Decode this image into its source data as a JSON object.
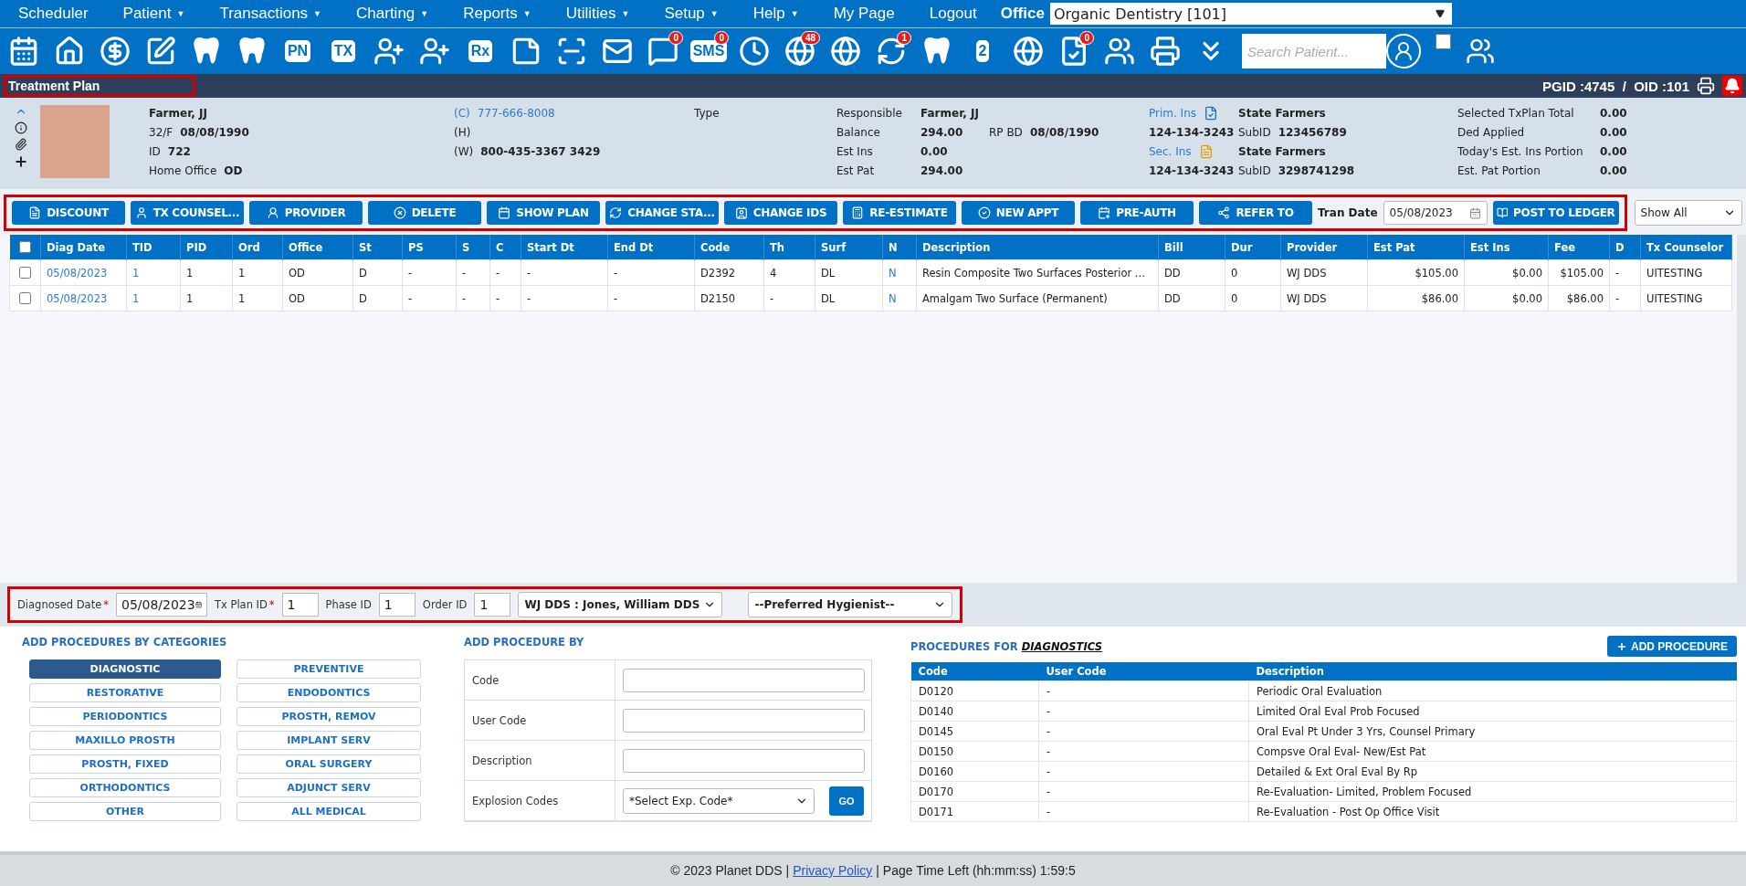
{
  "menu": [
    {
      "label": "Scheduler"
    },
    {
      "label": "Patient",
      "caret": "▼"
    },
    {
      "label": "Transactions",
      "caret": "▼"
    },
    {
      "label": "Charting",
      "caret": "▼"
    },
    {
      "label": "Reports",
      "caret": "▼"
    },
    {
      "label": "Utilities",
      "caret": "▼"
    },
    {
      "label": "Setup",
      "caret": "▼"
    },
    {
      "label": "Help",
      "caret": "▼"
    },
    {
      "label": "My Page"
    },
    {
      "label": "Logout"
    }
  ],
  "office": {
    "label": "Office",
    "value": "Organic Dentistry [101]"
  },
  "toolbar": [
    {
      "kind": "calendar"
    },
    {
      "kind": "home"
    },
    {
      "kind": "dollar"
    },
    {
      "kind": "edit"
    },
    {
      "kind": "tooth"
    },
    {
      "kind": "teeth"
    },
    {
      "kind": "text",
      "label": "PN"
    },
    {
      "kind": "text",
      "label": "TX"
    },
    {
      "kind": "user-plus"
    },
    {
      "kind": "user-plus"
    },
    {
      "kind": "text",
      "label": "Rx"
    },
    {
      "kind": "note"
    },
    {
      "kind": "scan"
    },
    {
      "kind": "mail"
    },
    {
      "kind": "chat",
      "badge": "0"
    },
    {
      "kind": "text",
      "label": "SMS",
      "badge": "0"
    },
    {
      "kind": "clock"
    },
    {
      "kind": "globe",
      "badge": "48"
    },
    {
      "kind": "globe"
    },
    {
      "kind": "sync",
      "badge": "1"
    },
    {
      "kind": "tooth"
    },
    {
      "kind": "text",
      "label": "2"
    },
    {
      "kind": "globe"
    },
    {
      "kind": "doc-check",
      "badge": "0"
    },
    {
      "kind": "group"
    },
    {
      "kind": "printer"
    },
    {
      "kind": "chevrons"
    }
  ],
  "search": {
    "placeholder": "Search Patient...",
    "option_checked": false
  },
  "page": {
    "title": "Treatment Plan",
    "ids": "PGID :4745  /  OID :101"
  },
  "patient": {
    "name": "Farmer, JJ",
    "age_sex": "32/F",
    "dob": "08/08/1990",
    "id_label": "ID",
    "id": "722",
    "home_office_label": "Home Office",
    "home_office": "OD",
    "phones": [
      {
        "label": "(C)",
        "value": "777-666-8008",
        "link": true
      },
      {
        "label": "(H)"
      },
      {
        "label": "(W)",
        "value": "800-435-3367 3429",
        "link": false
      }
    ],
    "type_label": "Type"
  },
  "account": [
    {
      "label": "Responsible",
      "value": "Farmer, JJ"
    },
    {
      "label": "Balance",
      "value": "294.00"
    },
    {
      "label": "Est Ins",
      "value": "0.00"
    },
    {
      "label": "Est Pat",
      "value": "294.00"
    }
  ],
  "rp_bd": {
    "label": "RP BD",
    "value": "08/08/1990"
  },
  "insurance": [
    {
      "label": "Prim. Ins",
      "phone": "124-134-3243",
      "carrier": "State Farmers",
      "subid_label": "SubID",
      "subid": "123456789"
    },
    {
      "label": "Sec. Ins",
      "phone": "124-134-3243",
      "carrier": "State Farmers",
      "subid_label": "SubID",
      "subid": "3298741298"
    }
  ],
  "totals": [
    {
      "label": "Selected TxPlan Total",
      "value": "0.00"
    },
    {
      "label": "Ded Applied",
      "value": "0.00"
    },
    {
      "label": "Today's Est. Ins Portion",
      "value": "0.00"
    },
    {
      "label": "Est. Pat Portion",
      "value": "0.00"
    }
  ],
  "actions": [
    "DISCOUNT",
    "TX COUNSEL...",
    "PROVIDER",
    "DELETE",
    "SHOW PLAN",
    "CHANGE STA...",
    "CHANGE IDS",
    "RE-ESTIMATE",
    "NEW APPT",
    "PRE-AUTH",
    "REFER TO"
  ],
  "tran_date": {
    "label": "Tran Date",
    "value": "05/08/2023"
  },
  "post_button": "POST TO LEDGER",
  "filter": "Show All",
  "table": {
    "all_checked": false,
    "columns": [
      {
        "label": "Diag Date",
        "link": true
      },
      {
        "label": "TID",
        "link": true
      },
      {
        "label": "PID",
        "link": false
      },
      {
        "label": "Ord",
        "link": false
      },
      {
        "label": "Office",
        "link": false
      },
      {
        "label": "St",
        "link": false
      },
      {
        "label": "PS",
        "link": false
      },
      {
        "label": "S",
        "link": false
      },
      {
        "label": "C",
        "link": false
      },
      {
        "label": "Start Dt",
        "link": false
      },
      {
        "label": "End Dt",
        "link": false
      },
      {
        "label": "Code",
        "link": false
      },
      {
        "label": "Th",
        "link": false
      },
      {
        "label": "Surf",
        "link": false
      },
      {
        "label": "N",
        "link": true
      },
      {
        "label": "Description",
        "link": false
      },
      {
        "label": "Bill",
        "link": false
      },
      {
        "label": "Dur",
        "link": false
      },
      {
        "label": "Provider",
        "link": false
      },
      {
        "label": "Est Pat",
        "link": false
      },
      {
        "label": "Est Ins",
        "link": false
      },
      {
        "label": "Fee",
        "link": false
      },
      {
        "label": "D",
        "link": false
      },
      {
        "label": "Tx Counselor",
        "link": false
      }
    ],
    "rows": [
      {
        "checked": false,
        "cells": [
          "05/08/2023",
          "1",
          "1",
          "1",
          "OD",
          "D",
          "-",
          "-",
          "-",
          "-",
          "-",
          "D2392",
          "4",
          "DL",
          "N",
          "Resin Composite Two Surfaces Posterior ...",
          "DD",
          "0",
          "WJ DDS",
          "$105.00",
          "$0.00",
          "$105.00",
          "-",
          "UITESTING"
        ]
      },
      {
        "checked": false,
        "cells": [
          "05/08/2023",
          "1",
          "1",
          "1",
          "OD",
          "D",
          "-",
          "-",
          "-",
          "-",
          "-",
          "D2150",
          "-",
          "DL",
          "N",
          "Amalgam Two Surface (Permanent)",
          "DD",
          "0",
          "WJ DDS",
          "$86.00",
          "$0.00",
          "$86.00",
          "-",
          "UITESTING"
        ]
      }
    ]
  },
  "form": {
    "fields": [
      {
        "label": "Diagnosed Date",
        "required_mark": "*",
        "value": "05/08/2023",
        "kind": "date"
      },
      {
        "label": "Tx Plan ID",
        "required_mark": "*",
        "value": "1",
        "kind": "text"
      },
      {
        "label": "Phase ID",
        "value": "1",
        "kind": "text"
      },
      {
        "label": "Order ID",
        "value": "1",
        "kind": "text"
      }
    ],
    "selects": [
      "WJ DDS : Jones, William DDS",
      "--Preferred Hygienist--"
    ]
  },
  "categories": {
    "title": "ADD PROCEDURES BY CATEGORIES",
    "items": [
      {
        "label": "DIAGNOSTIC",
        "selected": true
      },
      {
        "label": "PREVENTIVE",
        "selected": false
      },
      {
        "label": "RESTORATIVE",
        "selected": false
      },
      {
        "label": "ENDODONTICS",
        "selected": false
      },
      {
        "label": "PERIODONTICS",
        "selected": false
      },
      {
        "label": "PROSTH, REMOV",
        "selected": false
      },
      {
        "label": "MAXILLO PROSTH",
        "selected": false
      },
      {
        "label": "IMPLANT SERV",
        "selected": false
      },
      {
        "label": "PROSTH, FIXED",
        "selected": false
      },
      {
        "label": "ORAL SURGERY",
        "selected": false
      },
      {
        "label": "ORTHODONTICS",
        "selected": false
      },
      {
        "label": "ADJUNCT SERV",
        "selected": false
      },
      {
        "label": "OTHER",
        "selected": false
      },
      {
        "label": "ALL MEDICAL",
        "selected": false
      }
    ]
  },
  "add_by": {
    "title": "ADD PROCEDURE BY",
    "fields": [
      {
        "label": "Code",
        "kind": "input"
      },
      {
        "label": "User Code",
        "kind": "input"
      },
      {
        "label": "Description",
        "kind": "input"
      },
      {
        "label": "Explosion Codes",
        "kind": "select",
        "value": "*Select Exp. Code*",
        "button": "GO"
      }
    ]
  },
  "procedures": {
    "title": "PROCEDURES FOR",
    "category": "DIAGNOSTICS",
    "add_button": "ADD PROCEDURE",
    "columns": [
      "Code",
      "User Code",
      "Description"
    ],
    "rows": [
      [
        "D0120",
        "-",
        "Periodic Oral Evaluation"
      ],
      [
        "D0140",
        "-",
        "Limited Oral Eval Prob Focused"
      ],
      [
        "D0145",
        "-",
        "Oral Eval Pt Under 3 Yrs, Counsel Primary"
      ],
      [
        "D0150",
        "-",
        "Compsve Oral Eval- New/Est Pat"
      ],
      [
        "D0160",
        "-",
        "Detailed & Ext Oral Eval By Rp"
      ],
      [
        "D0170",
        "-",
        "Re-Evaluation- Limited, Problem Focused"
      ],
      [
        "D0171",
        "-",
        "Re-Evaluation - Post Op Office Visit"
      ]
    ]
  },
  "footer": {
    "copyright": "© 2023 Planet DDS |",
    "link": "Privacy Policy",
    "time": "| Page Time Left (hh:mm:ss) 1:59:5"
  }
}
